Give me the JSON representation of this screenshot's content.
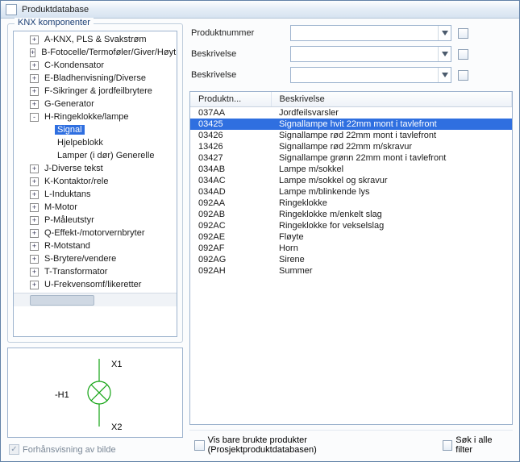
{
  "window": {
    "title": "Produktdatabase"
  },
  "tree": {
    "legend": "KNX komponenter",
    "nodes": [
      {
        "depth": 1,
        "expander": "+",
        "label": "A-KNX, PLS & Svakstrøm"
      },
      {
        "depth": 1,
        "expander": "+",
        "label": "B-Fotocelle/Termoføler/Giver/Høyt"
      },
      {
        "depth": 1,
        "expander": "+",
        "label": "C-Kondensator"
      },
      {
        "depth": 1,
        "expander": "+",
        "label": "E-Bladhenvisning/Diverse"
      },
      {
        "depth": 1,
        "expander": "+",
        "label": "F-Sikringer & jordfeilbrytere"
      },
      {
        "depth": 1,
        "expander": "+",
        "label": "G-Generator"
      },
      {
        "depth": 1,
        "expander": "-",
        "label": "H-Ringeklokke/lampe"
      },
      {
        "depth": 2,
        "expander": "",
        "label": "Signal",
        "selected": true
      },
      {
        "depth": 2,
        "expander": "",
        "label": "Hjelpeblokk"
      },
      {
        "depth": 2,
        "expander": "",
        "label": "Lamper (i dør) Generelle"
      },
      {
        "depth": 1,
        "expander": "+",
        "label": "J-Diverse tekst"
      },
      {
        "depth": 1,
        "expander": "+",
        "label": "K-Kontaktor/rele"
      },
      {
        "depth": 1,
        "expander": "+",
        "label": "L-Induktans"
      },
      {
        "depth": 1,
        "expander": "+",
        "label": "M-Motor"
      },
      {
        "depth": 1,
        "expander": "+",
        "label": "P-Måleutstyr"
      },
      {
        "depth": 1,
        "expander": "+",
        "label": "Q-Effekt-/motorvernbryter"
      },
      {
        "depth": 1,
        "expander": "+",
        "label": "R-Motstand"
      },
      {
        "depth": 1,
        "expander": "+",
        "label": "S-Brytere/vendere"
      },
      {
        "depth": 1,
        "expander": "+",
        "label": "T-Transformator"
      },
      {
        "depth": 1,
        "expander": "+",
        "label": "U-Frekvensomf/likeretter"
      }
    ]
  },
  "preview": {
    "ref": "-H1",
    "pin1": "X1",
    "pin2": "X2",
    "checkbox_label": "Forhånsvisning av bilde"
  },
  "filters": {
    "row1_label": "Produktnummer",
    "row2_label": "Beskrivelse",
    "row3_label": "Beskrivelse"
  },
  "table": {
    "col_product": "Produktn...",
    "col_desc": "Beskrivelse",
    "rows": [
      {
        "id": "037AA",
        "desc": "Jordfeilsvarsler"
      },
      {
        "id": "03425",
        "desc": "Signallampe hvit  22mm mont i tavlefront",
        "selected": true
      },
      {
        "id": "03426",
        "desc": "Signallampe rød   22mm mont i tavlefront"
      },
      {
        "id": "13426",
        "desc": "Signallampe rød   22mm m/skravur"
      },
      {
        "id": "03427",
        "desc": "Signallampe grønn 22mm mont i tavlefront"
      },
      {
        "id": "034AB",
        "desc": "Lampe m/sokkel"
      },
      {
        "id": "034AC",
        "desc": "Lampe m/sokkel og skravur"
      },
      {
        "id": "034AD",
        "desc": "Lampe m/blinkende lys"
      },
      {
        "id": "092AA",
        "desc": "Ringeklokke"
      },
      {
        "id": "092AB",
        "desc": "Ringeklokke m/enkelt slag"
      },
      {
        "id": "092AC",
        "desc": "Ringeklokke for vekselslag"
      },
      {
        "id": "092AE",
        "desc": "Fløyte"
      },
      {
        "id": "092AF",
        "desc": "Horn"
      },
      {
        "id": "092AG",
        "desc": "Sirene"
      },
      {
        "id": "092AH",
        "desc": "Summer"
      }
    ]
  },
  "bottom": {
    "only_used_label": "Vis bare brukte produkter (Prosjektproduktdatabasen)",
    "search_all_label": "Søk i alle filter"
  }
}
